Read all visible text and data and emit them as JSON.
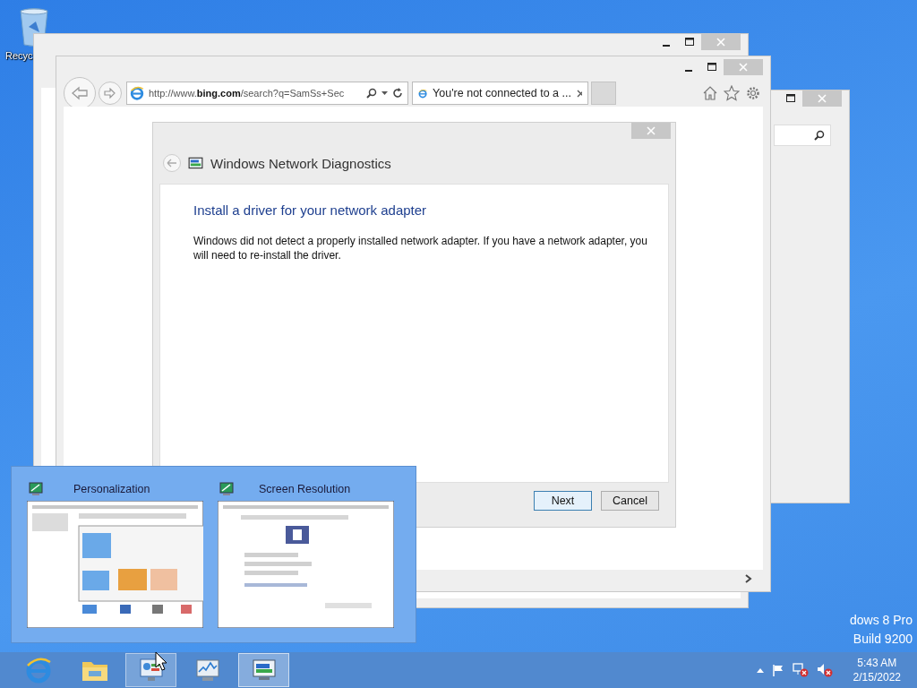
{
  "desktop": {
    "icons": [
      {
        "label": "Recyc"
      }
    ],
    "watermark": [
      "dows 8 Pro",
      "Build 9200"
    ]
  },
  "browser": {
    "address": "http://www.**bing.com**/search?q=SamSs+Sec",
    "tabs": [
      {
        "title": "You're not connected to a ...",
        "selected": true
      }
    ]
  },
  "dialog": {
    "title": "Windows Network Diagnostics",
    "heading": "Install a driver for your network adapter",
    "message": "Windows did not detect a properly installed network adapter. If you have a network adapter, you will need to re-install the driver.",
    "buttons": [
      {
        "label": "Next",
        "default": true
      },
      {
        "label": "Cancel",
        "default": false
      }
    ]
  },
  "thumbnails": [
    {
      "title": "Personalization",
      "kind": "personalization"
    },
    {
      "title": "Screen Resolution",
      "kind": "display"
    }
  ],
  "taskbar": {
    "items": [
      {
        "kind": "ie",
        "selected": false,
        "hovered": false
      },
      {
        "kind": "explorer",
        "selected": false,
        "hovered": false
      },
      {
        "kind": "control-panel",
        "selected": false,
        "hovered": true
      },
      {
        "kind": "monitor",
        "selected": false,
        "hovered": false
      },
      {
        "kind": "network",
        "selected": true,
        "hovered": false
      }
    ],
    "tray": {
      "network_error": true,
      "muted": true,
      "time": "5:43 AM",
      "date": "2/15/2022"
    }
  }
}
